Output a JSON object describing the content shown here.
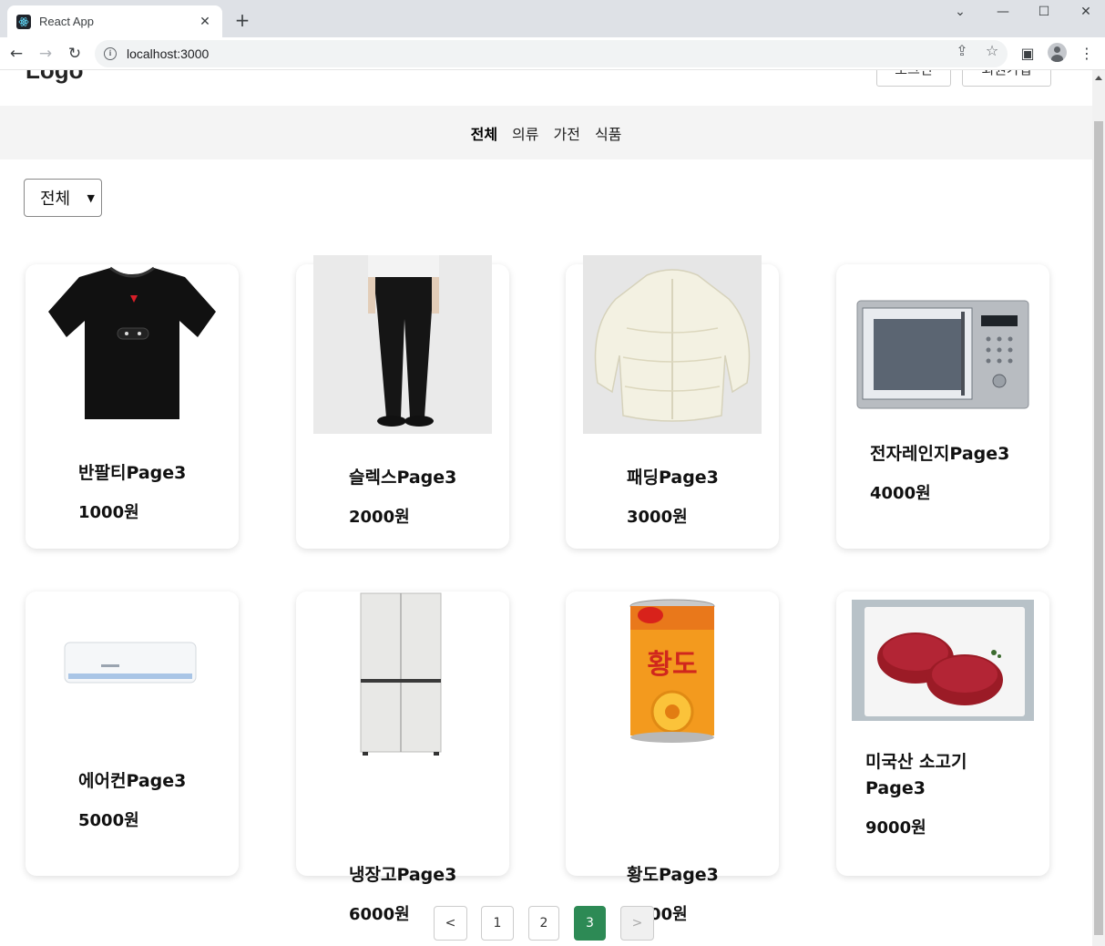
{
  "browser": {
    "tab_title": "React App",
    "tab_close": "✕",
    "new_tab": "+",
    "url": "localhost:3000",
    "window_controls": {
      "dropdown": "⌄",
      "minimize": "—",
      "maximize": "☐",
      "close": "✕"
    },
    "icons": [
      "back-icon",
      "forward-icon",
      "reload-icon",
      "info-icon",
      "share-icon",
      "star-icon",
      "side-panel-icon",
      "profile-icon",
      "menu-icon"
    ]
  },
  "header": {
    "logo": "Logo",
    "login_label": "로그인",
    "signup_label": "회원가입"
  },
  "nav": {
    "categories": [
      "전체",
      "의류",
      "가전",
      "식품"
    ],
    "active_index": 0
  },
  "filter": {
    "selected": "전체"
  },
  "products": [
    {
      "name": "반팔티Page3",
      "price": "1000원",
      "image": "tshirt-image"
    },
    {
      "name": "슬렉스Page3",
      "price": "2000원",
      "image": "slacks-image"
    },
    {
      "name": "패딩Page3",
      "price": "3000원",
      "image": "padding-image"
    },
    {
      "name": "전자레인지Page3",
      "price": "4000원",
      "image": "microwave-image"
    },
    {
      "name": "에어컨Page3",
      "price": "5000원",
      "image": "aircon-image"
    },
    {
      "name": "냉장고Page3",
      "price": "6000원",
      "image": "fridge-image"
    },
    {
      "name": "황도Page3",
      "price": "7500원",
      "image": "peach-can-image"
    },
    {
      "name": "미국산 소고기 Page3",
      "price": "9000원",
      "image": "beef-image"
    }
  ],
  "pagination": {
    "prev": "<",
    "pages": [
      "1",
      "2",
      "3"
    ],
    "current": "3",
    "next": ">"
  },
  "colors": {
    "accent": "#2d8a55",
    "nav_bg": "#f4f4f4"
  }
}
